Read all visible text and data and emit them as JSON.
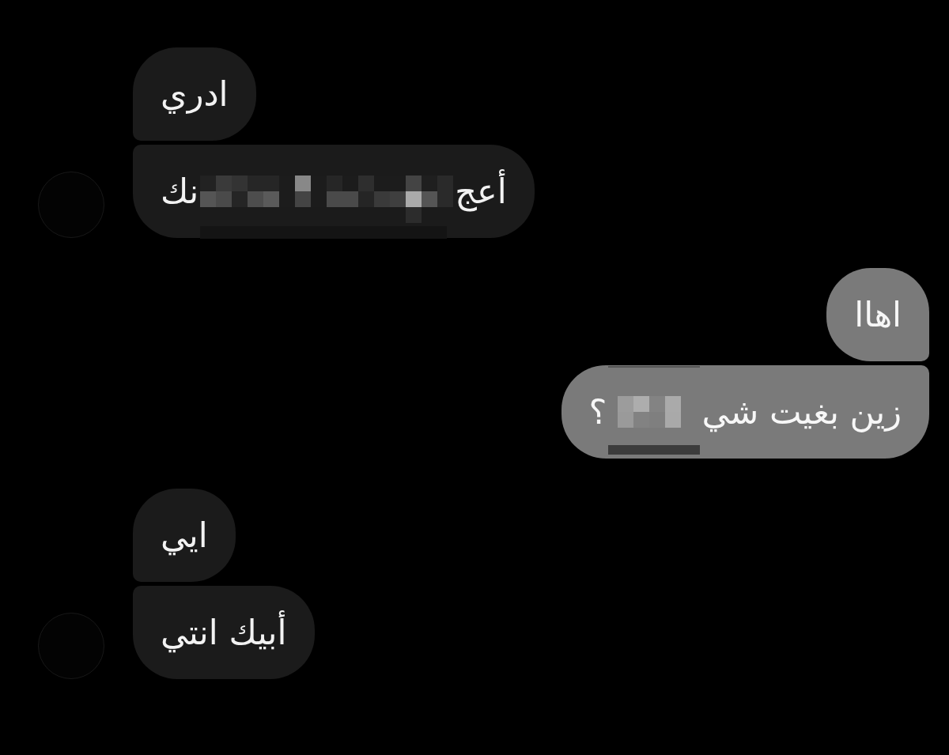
{
  "messages": [
    {
      "kind": "incoming",
      "avatar": false,
      "segments": [
        {
          "kind": "text",
          "text": "ادري"
        }
      ]
    },
    {
      "kind": "incoming",
      "avatar": true,
      "segments": [
        {
          "kind": "text",
          "text": "أعج"
        },
        {
          "kind": "redacted"
        },
        {
          "kind": "text",
          "text": "نك"
        }
      ]
    },
    {
      "kind": "outgoing",
      "avatar": false,
      "segments": [
        {
          "kind": "text",
          "text": "اهاا"
        }
      ]
    },
    {
      "kind": "outgoing",
      "avatar": false,
      "segments": [
        {
          "kind": "text",
          "text": "زين بغيت شي"
        },
        {
          "kind": "redacted"
        },
        {
          "kind": "text",
          "text": "؟"
        }
      ]
    },
    {
      "kind": "incoming",
      "avatar": false,
      "segments": [
        {
          "kind": "text",
          "text": "ايي"
        }
      ]
    },
    {
      "kind": "incoming",
      "avatar": true,
      "segments": [
        {
          "kind": "text",
          "text": "أبيك انتي"
        }
      ]
    }
  ]
}
